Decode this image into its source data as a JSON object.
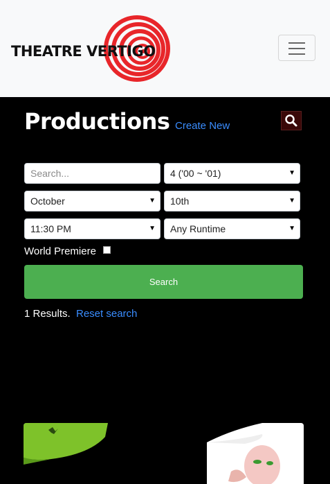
{
  "brand": {
    "name": "THEATRE VERTIGO",
    "spiral_color": "#e8262a"
  },
  "nav": {
    "toggle_icon": "hamburger-icon"
  },
  "page": {
    "title": "Productions",
    "create_new": "Create New",
    "search_icon": "search-icon"
  },
  "filters": {
    "search_placeholder": "Search...",
    "season": "4 ('00 ~ '01)",
    "month": "October",
    "day": "10th",
    "time": "11:30 PM",
    "runtime": "Any Runtime",
    "world_premiere_label": "World Premiere",
    "world_premiere_checked": false
  },
  "search_button": "Search",
  "results": {
    "summary": "1 Results.",
    "reset": "Reset search"
  },
  "colors": {
    "accent": "#4caf50",
    "link": "#3a8dff",
    "background": "#000000"
  }
}
